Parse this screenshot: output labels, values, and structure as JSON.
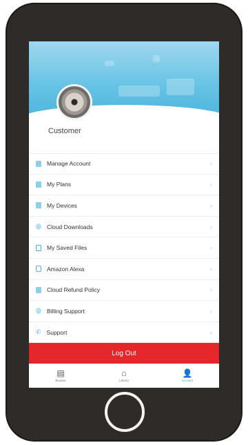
{
  "profile": {
    "name": "Customer"
  },
  "menu": [
    {
      "label": "Manage Account",
      "icon": "user-icon"
    },
    {
      "label": "My Plans",
      "icon": "document-icon"
    },
    {
      "label": "My Devices",
      "icon": "device-icon"
    },
    {
      "label": "Cloud Downloads",
      "icon": "cloud-download-icon"
    },
    {
      "label": "My Saved Files",
      "icon": "folder-icon"
    },
    {
      "label": "Amazon Alexa",
      "icon": "alexa-icon"
    },
    {
      "label": "Cloud Refund Policy",
      "icon": "refund-icon"
    },
    {
      "label": "Billing Support",
      "icon": "billing-icon"
    },
    {
      "label": "Support",
      "icon": "phone-icon"
    }
  ],
  "logout_label": "Log Out",
  "tabs": [
    {
      "label": "Browse",
      "icon": "browse-icon"
    },
    {
      "label": "Library",
      "icon": "library-icon"
    },
    {
      "label": "Account",
      "icon": "account-icon"
    }
  ],
  "colors": {
    "accent": "#4fb5dd",
    "logout": "#e5262b",
    "phone_body": "#2e2c2b"
  }
}
